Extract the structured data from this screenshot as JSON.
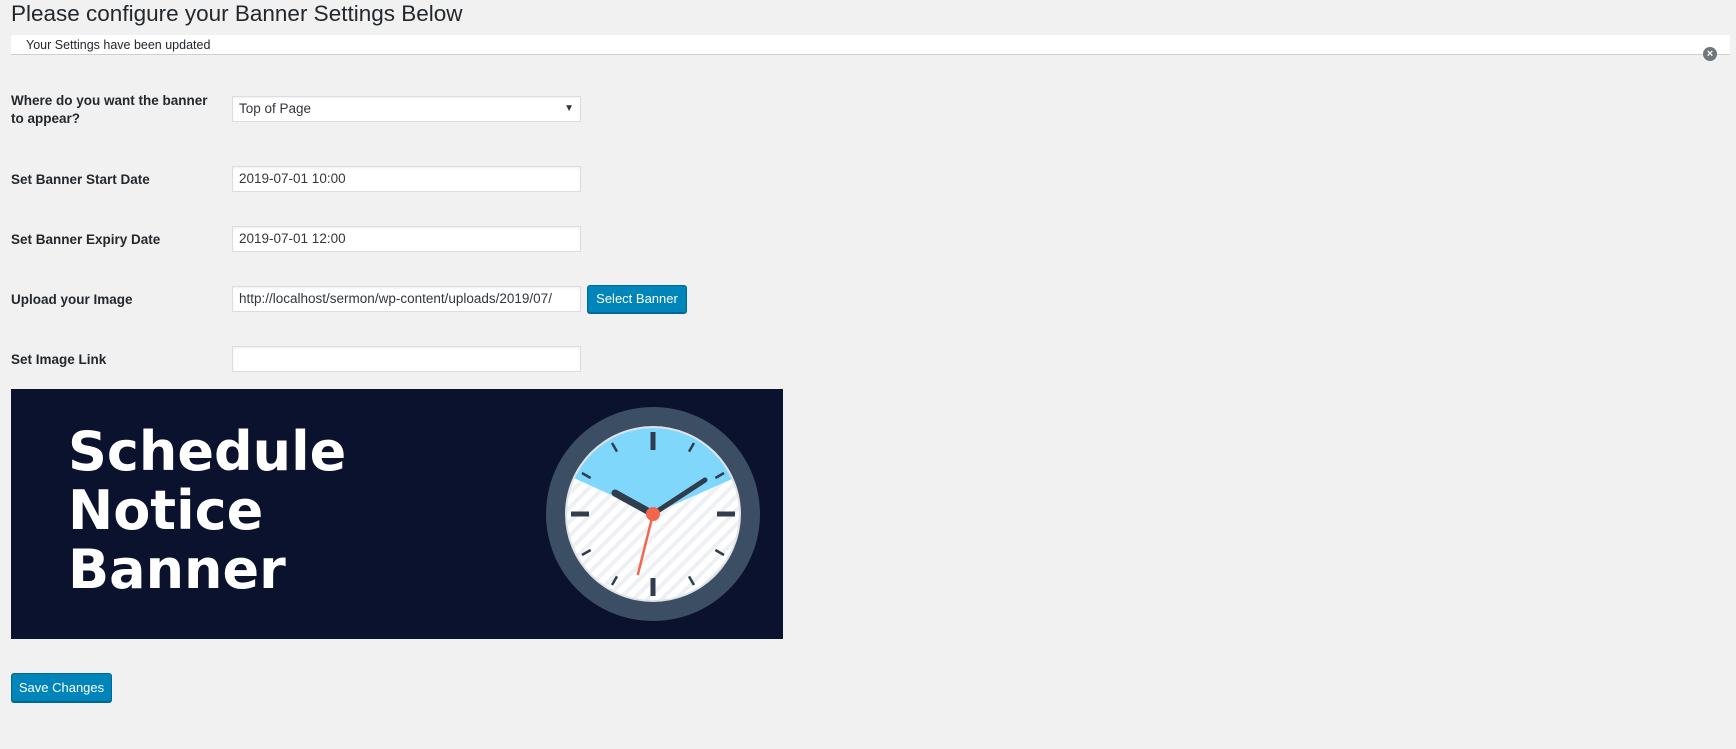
{
  "page": {
    "title": "Please configure your Banner Settings Below"
  },
  "notice": {
    "message": "Your Settings have been updated",
    "dismiss_icon": "close-circle-icon"
  },
  "form": {
    "position": {
      "label_line1": "Where do you want the banner",
      "label_line2": "to appear?",
      "selected": "Top of Page",
      "arrow_icon": "caret-down-icon"
    },
    "start_date": {
      "label": "Set Banner Start Date",
      "value": "2019-07-01 10:00"
    },
    "expiry_date": {
      "label": "Set Banner Expiry Date",
      "value": "2019-07-01 12:00"
    },
    "image": {
      "label": "Upload your Image",
      "value": "http://localhost/sermon/wp-content/uploads/2019/07/",
      "button": "Select Banner"
    },
    "link": {
      "label": "Set Image Link",
      "value": ""
    }
  },
  "banner": {
    "line1": "Schedule",
    "line2": "Notice",
    "line3": "Banner",
    "bg_color": "#0a122d",
    "clock_icon": "clock-icon"
  },
  "actions": {
    "save": "Save Changes"
  },
  "colors": {
    "primary_button": "#0085ba",
    "background": "#f1f1f1"
  }
}
